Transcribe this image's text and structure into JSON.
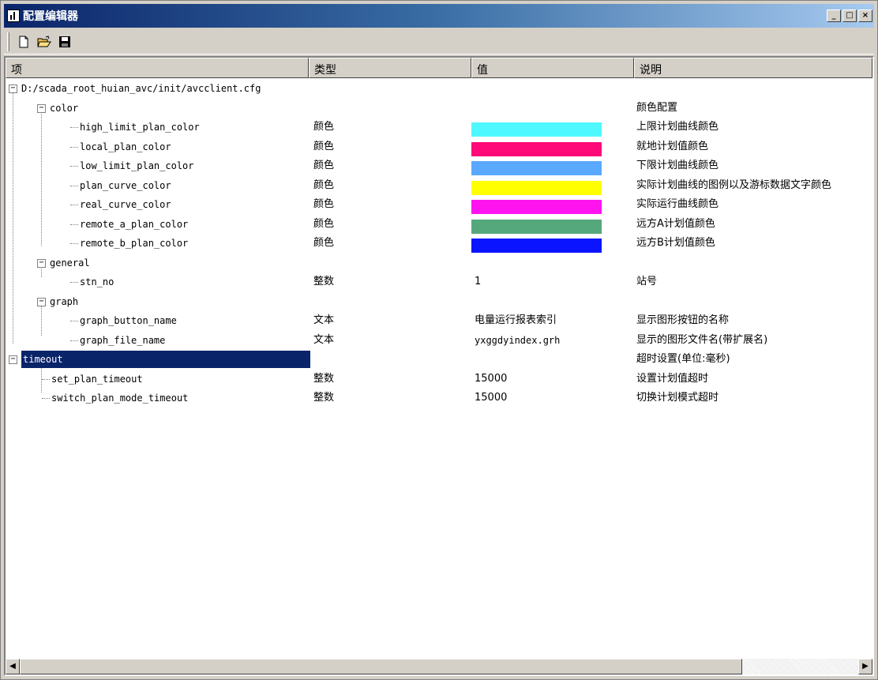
{
  "window": {
    "title": "配置编辑器",
    "minimize": "_",
    "maximize": "□",
    "close": "×"
  },
  "toolbar": {
    "new_icon": "new-file-icon",
    "open_icon": "open-folder-icon",
    "save_icon": "save-disk-icon"
  },
  "columns": {
    "item": "项",
    "type": "类型",
    "value": "值",
    "desc": "说明"
  },
  "tree": {
    "root": "D:/scada_root_huian_avc/init/avcclient.cfg",
    "groups": [
      {
        "name": "color",
        "desc": "颜色配置",
        "items": [
          {
            "name": "high_limit_plan_color",
            "type": "颜色",
            "color": "#4ff8ff",
            "desc": "上限计划曲线颜色"
          },
          {
            "name": "local_plan_color",
            "type": "颜色",
            "color": "#ff0a78",
            "desc": "就地计划值颜色"
          },
          {
            "name": "low_limit_plan_color",
            "type": "颜色",
            "color": "#5aa9ff",
            "desc": "下限计划曲线颜色"
          },
          {
            "name": "plan_curve_color",
            "type": "颜色",
            "color": "#ffff00",
            "desc": "实际计划曲线的图例以及游标数据文字颜色"
          },
          {
            "name": "real_curve_color",
            "type": "颜色",
            "color": "#ff14f0",
            "desc": "实际运行曲线颜色"
          },
          {
            "name": "remote_a_plan_color",
            "type": "颜色",
            "color": "#55a87b",
            "desc": "远方A计划值颜色"
          },
          {
            "name": "remote_b_plan_color",
            "type": "颜色",
            "color": "#0a14ff",
            "desc": "远方B计划值颜色"
          }
        ]
      },
      {
        "name": "general",
        "desc": "",
        "items": [
          {
            "name": "stn_no",
            "type": "整数",
            "value": "1",
            "desc": "站号"
          }
        ]
      },
      {
        "name": "graph",
        "desc": "",
        "items": [
          {
            "name": "graph_button_name",
            "type": "文本",
            "value": "电量运行报表索引",
            "desc": "显示图形按钮的名称"
          },
          {
            "name": "graph_file_name",
            "type": "文本",
            "value": "yxggdyindex.grh",
            "desc": "显示的图形文件名(带扩展名)"
          }
        ]
      },
      {
        "name": "timeout",
        "desc": "超时设置(单位:毫秒)",
        "selected": true,
        "items": [
          {
            "name": "set_plan_timeout",
            "type": "整数",
            "value": "15000",
            "desc": "设置计划值超时"
          },
          {
            "name": "switch_plan_mode_timeout",
            "type": "整数",
            "value": "15000",
            "desc": "切换计划模式超时"
          }
        ]
      }
    ]
  },
  "scrollbar": {
    "left_arrow": "◀",
    "right_arrow": "▶"
  },
  "colors": {
    "selection": "#0a246a",
    "titlebar_start": "#0a246a",
    "titlebar_end": "#a6caf0"
  }
}
